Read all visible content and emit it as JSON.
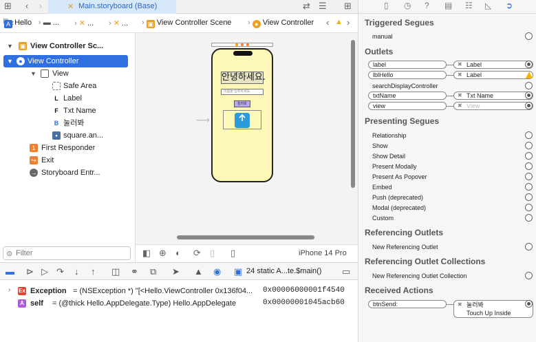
{
  "editor_tab": {
    "title": "Main.storyboard (Base)"
  },
  "jumpbar": {
    "project": "Hello",
    "folder": "...",
    "file": "...",
    "file2": "...",
    "scene": "View Controller Scene",
    "controller": "View Controller"
  },
  "navigator": {
    "items": [
      {
        "label": "View Controller Sc..."
      },
      {
        "label": "View Controller"
      },
      {
        "label": "View"
      },
      {
        "label": "Safe Area"
      },
      {
        "label": "Label"
      },
      {
        "label": "Txt Name"
      },
      {
        "label": "눌러봐"
      },
      {
        "label": "square.an..."
      },
      {
        "label": "First Responder"
      },
      {
        "label": "Exit"
      },
      {
        "label": "Storyboard Entr..."
      }
    ],
    "filter_placeholder": "Filter"
  },
  "canvas": {
    "hello_label": "안녕하세요.",
    "textfield_placeholder": "이름을 입력하세요.",
    "button_label": "눌러봐",
    "device_name": "iPhone 14 Pro"
  },
  "debugger": {
    "frame_number": "24",
    "frame_label": "static A...te.$main()",
    "vars": [
      {
        "tag": "Ex",
        "name": "Exception",
        "value": "= (NSException *) \"[<Hello.ViewController 0x136f04...",
        "address": "0x00006000001f4540"
      },
      {
        "tag": "A",
        "name": "self",
        "value": "= (@thick Hello.AppDelegate.Type) Hello.AppDelegate",
        "address": "0x00000001045acb60"
      }
    ]
  },
  "inspector": {
    "triggered_segues": {
      "title": "Triggered Segues",
      "items": [
        "manual"
      ]
    },
    "outlets": {
      "title": "Outlets",
      "items": [
        {
          "name": "label",
          "target": "Label"
        },
        {
          "name": "lblHello",
          "target": "Label",
          "warning": true
        },
        {
          "name": "searchDisplayController",
          "target": ""
        },
        {
          "name": "txtName",
          "target": "Txt Name"
        },
        {
          "name": "view",
          "target": "View",
          "empty": true
        }
      ]
    },
    "presenting_segues": {
      "title": "Presenting Segues",
      "items": [
        "Relationship",
        "Show",
        "Show Detail",
        "Present Modally",
        "Present As Popover",
        "Embed",
        "Push (deprecated)",
        "Modal (deprecated)",
        "Custom"
      ]
    },
    "referencing_outlets": {
      "title": "Referencing Outlets",
      "item": "New Referencing Outlet"
    },
    "referencing_collections": {
      "title": "Referencing Outlet Collections",
      "item": "New Referencing Outlet Collection"
    },
    "received_actions": {
      "title": "Received Actions",
      "action": "btnSend:",
      "target": "눌러봐",
      "event": "Touch Up Inside"
    }
  },
  "colors": {
    "accent": "#2f6fe0",
    "canvas_bg": "#fdf7b8",
    "button_bg": "#b9a8ee"
  }
}
